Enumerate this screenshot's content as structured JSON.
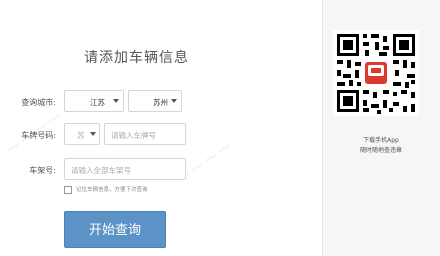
{
  "form": {
    "title": "请添加车辆信息",
    "city_label": "查询城市:",
    "province_value": "江苏",
    "city_value": "苏州",
    "plate_label": "车牌号码:",
    "plate_prefix": "苏",
    "plate_placeholder": "请输入车牌号",
    "frame_label": "车架号:",
    "frame_placeholder": "请输入全部车架号",
    "remember_text": "记住车辆信息，方便下次查询",
    "submit_label": "开始查询"
  },
  "sidebar": {
    "qr_icon": "qr-code",
    "download_line1": "下载手机App",
    "download_line2": "随时随地查违章"
  },
  "colors": {
    "button": "#5b93c6",
    "sidebar_bg": "#f6f6f6",
    "watermark": "#78aad2"
  }
}
